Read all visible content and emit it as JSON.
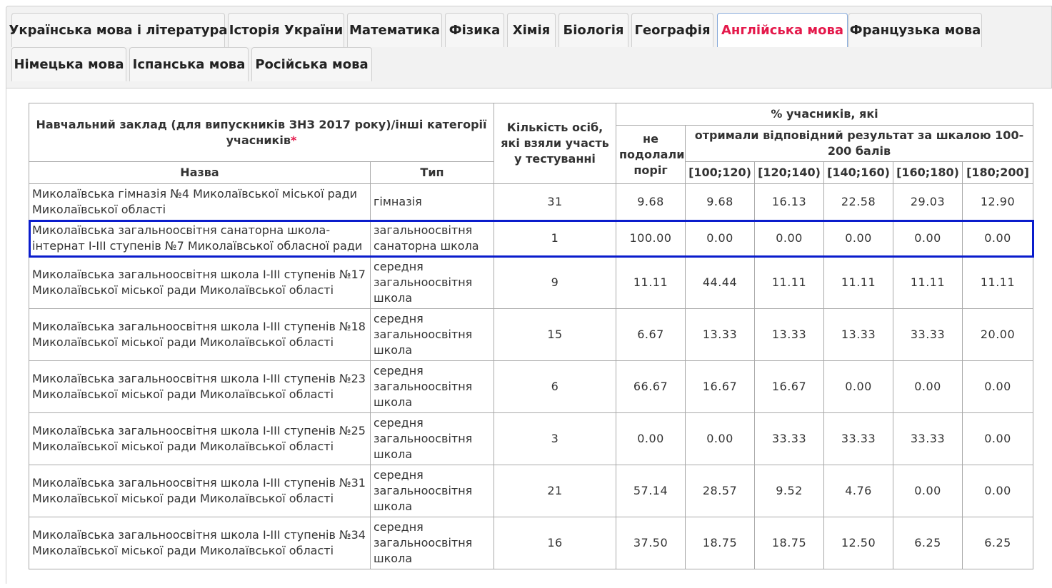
{
  "tabs": [
    {
      "label": "Українська мова і література",
      "active": false
    },
    {
      "label": "Історія України",
      "active": false
    },
    {
      "label": "Математика",
      "active": false
    },
    {
      "label": "Фізика",
      "active": false
    },
    {
      "label": "Хімія",
      "active": false
    },
    {
      "label": "Біологія",
      "active": false
    },
    {
      "label": "Географія",
      "active": false
    },
    {
      "label": "Англійська мова",
      "active": true
    },
    {
      "label": "Французька мова",
      "active": false
    },
    {
      "label": "Німецька мова",
      "active": false
    },
    {
      "label": "Іспанська мова",
      "active": false
    },
    {
      "label": "Російська мова",
      "active": false
    }
  ],
  "table": {
    "header": {
      "institution": "Навчальний заклад (для випускників ЗНЗ 2017 року)/інші категорії учасників",
      "required_mark": "*",
      "name": "Назва",
      "type": "Тип",
      "count": "Кількість осіб, які взяли участь у тестуванні",
      "percent_group": "% учасників, які",
      "not_passed": "не подолали поріг",
      "scale_group": "отримали відповідний результат за шкалою 100-200 балів",
      "ranges": [
        "[100;120)",
        "[120;140)",
        "[140;160)",
        "[160;180)",
        "[180;200]"
      ]
    },
    "rows": [
      {
        "name": "Миколаївська гімназія №4 Миколаївської міської ради Миколаївської області",
        "type": "гімназія",
        "count": "31",
        "not_passed": "9.68",
        "values": [
          "9.68",
          "16.13",
          "22.58",
          "29.03",
          "12.90"
        ],
        "selected": false
      },
      {
        "name": "Миколаївська загальноосвітня санаторна школа-інтернат І-ІІІ ступенів №7 Миколаївської обласної ради",
        "type": "загальноосвітня санаторна школа",
        "count": "1",
        "not_passed": "100.00",
        "values": [
          "0.00",
          "0.00",
          "0.00",
          "0.00",
          "0.00"
        ],
        "selected": true
      },
      {
        "name": "Миколаївська загальноосвітня школа І-ІІІ ступенів №17 Миколаївської міської ради Миколаївської області",
        "type": "середня загальноосвітня школа",
        "count": "9",
        "not_passed": "11.11",
        "values": [
          "44.44",
          "11.11",
          "11.11",
          "11.11",
          "11.11"
        ],
        "selected": false
      },
      {
        "name": "Миколаївська загальноосвітня школа І-ІІІ ступенів №18 Миколаївської міської ради Миколаївської області",
        "type": "середня загальноосвітня школа",
        "count": "15",
        "not_passed": "6.67",
        "values": [
          "13.33",
          "13.33",
          "13.33",
          "33.33",
          "20.00"
        ],
        "selected": false
      },
      {
        "name": "Миколаївська загальноосвітня школа І-ІІІ ступенів №23 Миколаївської міської ради Миколаївської області",
        "type": "середня загальноосвітня школа",
        "count": "6",
        "not_passed": "66.67",
        "values": [
          "16.67",
          "16.67",
          "0.00",
          "0.00",
          "0.00"
        ],
        "selected": false
      },
      {
        "name": "Миколаївська загальноосвітня школа І-ІІІ ступенів №25 Миколаївської міської ради Миколаївської області",
        "type": "середня загальноосвітня школа",
        "count": "3",
        "not_passed": "0.00",
        "values": [
          "0.00",
          "33.33",
          "33.33",
          "33.33",
          "0.00"
        ],
        "selected": false
      },
      {
        "name": "Миколаївська загальноосвітня школа І-ІІІ ступенів №31 Миколаївської міської ради Миколаївської області",
        "type": "середня загальноосвітня школа",
        "count": "21",
        "not_passed": "57.14",
        "values": [
          "28.57",
          "9.52",
          "4.76",
          "0.00",
          "0.00"
        ],
        "selected": false
      },
      {
        "name": "Миколаївська загальноосвітня школа І-ІІІ ступенів №34 Миколаївської міської ради Миколаївської області",
        "type": "середня загальноосвітня школа",
        "count": "16",
        "not_passed": "37.50",
        "values": [
          "18.75",
          "18.75",
          "12.50",
          "6.25",
          "6.25"
        ],
        "selected": false
      }
    ]
  }
}
